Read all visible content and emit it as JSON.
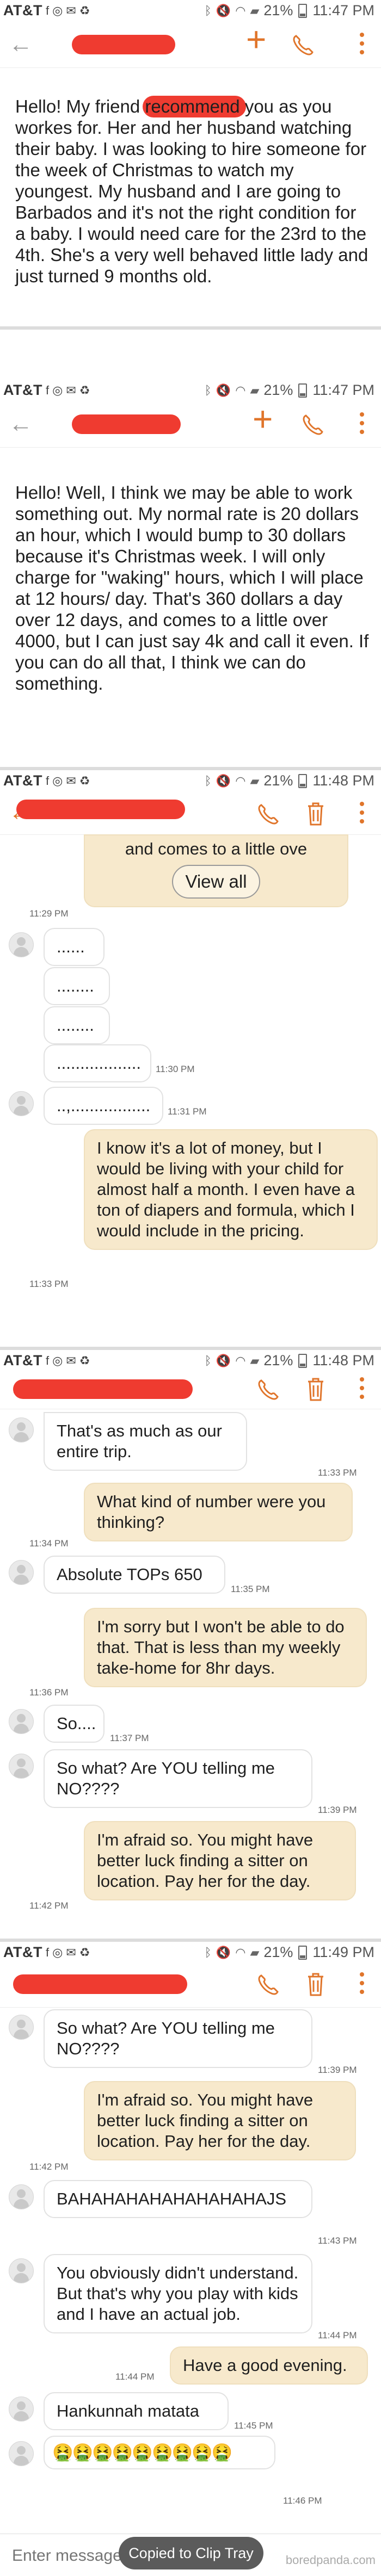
{
  "status_bars": [
    {
      "carrier": "AT&T",
      "battery": "21%",
      "time": "11:47 PM"
    },
    {
      "carrier": "AT&T",
      "battery": "21%",
      "time": "11:47 PM"
    },
    {
      "carrier": "AT&T",
      "battery": "21%",
      "time": "11:48 PM"
    },
    {
      "carrier": "AT&T",
      "battery": "21%",
      "time": "11:48 PM"
    },
    {
      "carrier": "AT&T",
      "battery": "21%",
      "time": "11:49 PM"
    }
  ],
  "panel1": {
    "text": "Hello! My friend                         recommend you as you workes for. Her and her husband watching their baby. I was looking to hire someone for the week of Christmas to watch my youngest. My husband and I are going to Barbados and it's not the right condition for a baby. I would need care for the 23rd to the 4th. She's a very well behaved  little lady and just turned 9 months old."
  },
  "panel2": {
    "text": "Hello! Well, I think we may be able to work something out. My normal rate is 20 dollars an hour, which I would bump to 30 dollars because it's Christmas week. I will only charge for \"waking\" hours, which I will place at 12 hours/ day. That's 360 dollars a day over 12 days, and comes to a little over 4000, but I can just  say 4k and call it even. If you can do all that, I think we can do something."
  },
  "panel3": {
    "top_out_text": "and comes to a little ove",
    "view_all": "View all",
    "top_out_time": "11:29 PM",
    "dots": [
      "......",
      "........",
      "........",
      "..................",
      "..,................."
    ],
    "dots_time_1": "11:30 PM",
    "dots_time_2": "11:31 PM",
    "out_text": "I know it's a lot of money, but I would be living with your child for almost half a month. I even have a ton of diapers and formula, which I would include in the pricing.",
    "out_time": "11:33 PM"
  },
  "panel4": {
    "messages": [
      {
        "dir": "in",
        "text": "That's as much as our entire trip.",
        "time": "11:33 PM"
      },
      {
        "dir": "out",
        "text": "What kind of number were you thinking?",
        "time": "11:34 PM"
      },
      {
        "dir": "in",
        "text": "Absolute TOPs 650",
        "time": "11:35 PM"
      },
      {
        "dir": "out",
        "text": "I'm sorry but I won't be able to do that. That is less than my weekly take-home for 8hr days.",
        "time": "11:36 PM"
      },
      {
        "dir": "in",
        "text": "So....",
        "time": "11:37 PM"
      },
      {
        "dir": "in",
        "text": "So what? Are YOU telling me NO????",
        "time": "11:39 PM"
      },
      {
        "dir": "out",
        "text": "I'm afraid so. You might have better luck finding a sitter on location. Pay her for the day.",
        "time": "11:42 PM"
      }
    ]
  },
  "panel5": {
    "messages": [
      {
        "dir": "in",
        "text": "So what? Are YOU telling me NO????",
        "time": "11:39 PM"
      },
      {
        "dir": "out",
        "text": "I'm afraid so. You might have better luck finding a sitter on location. Pay her for the day.",
        "time": "11:42 PM"
      },
      {
        "dir": "in",
        "text": "BAHAHAHAHAHAHAHAHAJS",
        "time": "11:43 PM"
      },
      {
        "dir": "in",
        "text": "You obviously didn't understand. But that's why you play with kids and I have an actual job.",
        "time": "11:44 PM"
      },
      {
        "dir": "out",
        "text": "Have a good evening.",
        "time": "11:44 PM"
      },
      {
        "dir": "in",
        "text": "Hankunnah matata",
        "time": "11:45 PM"
      },
      {
        "dir": "in",
        "text": "🤮🤮🤮🤮🤮🤮🤮🤮🤮",
        "time": "11:46 PM"
      }
    ]
  },
  "input": {
    "placeholder": "Enter message"
  },
  "toast": "Copied to Clip Tray",
  "watermark": "boredpanda.com",
  "colors": {
    "accent": "#e0752b",
    "redaction": "#ef3b30",
    "out_bubble": "#f7e9cc"
  }
}
